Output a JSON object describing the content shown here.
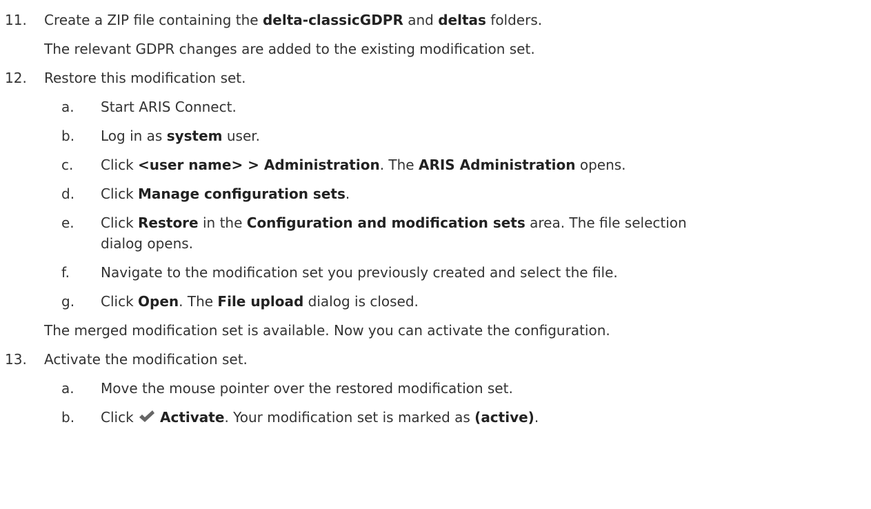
{
  "step11": {
    "number": "11.",
    "t1": "Create a ZIP file containing the ",
    "b1": "delta-classicGDPR",
    "t2": " and ",
    "b2": "deltas",
    "t3": " folders.",
    "result": "The relevant GDPR changes are added to the existing modification set."
  },
  "step12": {
    "number": "12.",
    "text": "Restore this modification set.",
    "a": {
      "letter": "a.",
      "text": "Start ARIS Connect."
    },
    "b": {
      "letter": "b.",
      "t1": "Log in as ",
      "b1": "system",
      "t2": " user."
    },
    "c": {
      "letter": "c.",
      "t1": "Click ",
      "b1": "<user name> > Administration",
      "t2": ". The ",
      "b2": "ARIS Administration",
      "t3": " opens."
    },
    "d": {
      "letter": "d.",
      "t1": "Click ",
      "b1": "Manage configuration sets",
      "t2": "."
    },
    "e": {
      "letter": "e.",
      "t1": "Click ",
      "b1": "Restore",
      "t2": " in the ",
      "b2": "Configuration and modification sets",
      "t3": " area. The file selection",
      "line2": "dialog opens."
    },
    "f": {
      "letter": "f.",
      "text": "Navigate to the modification set you previously created and select the file."
    },
    "g": {
      "letter": "g.",
      "t1": "Click ",
      "b1": "Open",
      "t2": ". The ",
      "b2": "File upload",
      "t3": " dialog is closed."
    },
    "result": "The merged modification set is available. Now you can activate the configuration."
  },
  "step13": {
    "number": "13.",
    "text": "Activate the modification set.",
    "a": {
      "letter": "a.",
      "text": "Move the mouse pointer over the restored modification set."
    },
    "b": {
      "letter": "b.",
      "t1": "Click ",
      "icon": "checkmark-icon",
      "b1": "Activate",
      "t2": ". Your modification set is marked as ",
      "b2": "(active)",
      "t3": "."
    }
  },
  "colors": {
    "text": "#333333",
    "icon": "#666666"
  }
}
